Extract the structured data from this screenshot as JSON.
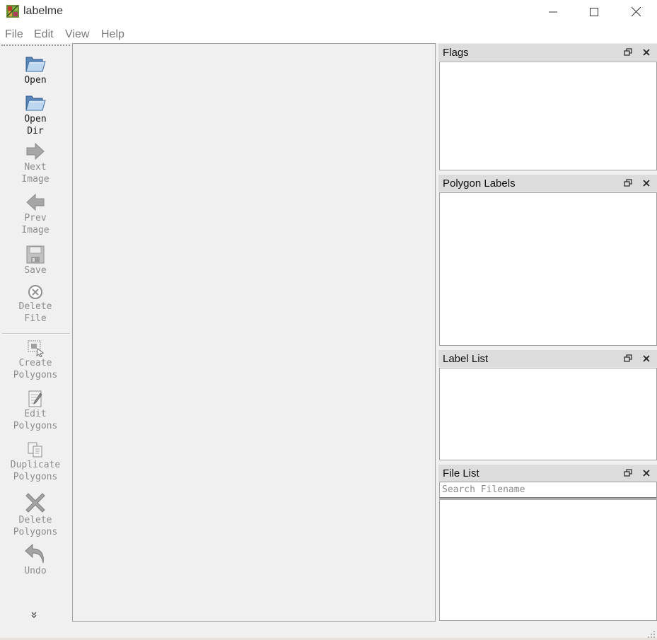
{
  "window": {
    "title": "labelme"
  },
  "menubar": {
    "items": [
      "File",
      "Edit",
      "View",
      "Help"
    ]
  },
  "toolbar": {
    "tools": [
      {
        "label": "Open",
        "icon": "folder-open-icon",
        "enabled": true
      },
      {
        "label": "Open\nDir",
        "icon": "folder-open-icon",
        "enabled": true
      },
      {
        "label": "Next\nImage",
        "icon": "arrow-right-icon",
        "enabled": false
      },
      {
        "label": "Prev\nImage",
        "icon": "arrow-left-icon",
        "enabled": false
      },
      {
        "label": "Save",
        "icon": "floppy-disk-icon",
        "enabled": false
      },
      {
        "label": "Delete\nFile",
        "icon": "delete-circle-icon",
        "enabled": false
      },
      {
        "label": "Create\nPolygons",
        "icon": "create-polygon-icon",
        "enabled": false
      },
      {
        "label": "Edit\nPolygons",
        "icon": "edit-document-icon",
        "enabled": false
      },
      {
        "label": "Duplicate\nPolygons",
        "icon": "duplicate-icon",
        "enabled": false
      },
      {
        "label": "Delete\nPolygons",
        "icon": "delete-x-icon",
        "enabled": false
      },
      {
        "label": "Undo",
        "icon": "undo-arrow-icon",
        "enabled": false
      }
    ],
    "extension": "»"
  },
  "docks": {
    "flags": {
      "title": "Flags"
    },
    "polygon_labels": {
      "title": "Polygon Labels"
    },
    "label_list": {
      "title": "Label List"
    },
    "file_list": {
      "title": "File List",
      "search_placeholder": "Search Filename",
      "search_value": ""
    }
  },
  "statusbar": {
    "text": ""
  },
  "colors": {
    "dock_title_bg": "#dcdcdc",
    "panel_bg": "#ffffff",
    "window_bg": "#f0f0f0",
    "disabled_text": "#8c8c8c"
  }
}
